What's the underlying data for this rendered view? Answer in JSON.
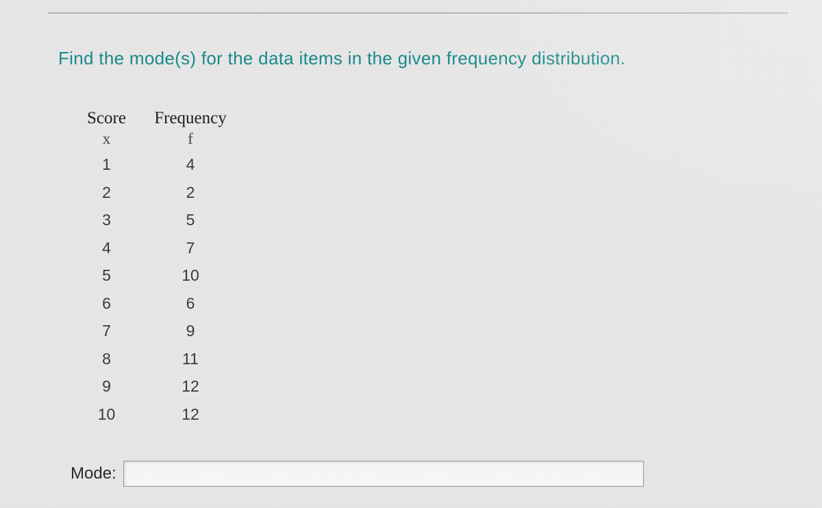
{
  "question": "Find the mode(s) for the data items in the given frequency distribution.",
  "table": {
    "header_score": "Score",
    "header_freq": "Frequency",
    "sym_score": "x",
    "sym_freq": "f",
    "rows": [
      {
        "x": "1",
        "f": "4"
      },
      {
        "x": "2",
        "f": "2"
      },
      {
        "x": "3",
        "f": "5"
      },
      {
        "x": "4",
        "f": "7"
      },
      {
        "x": "5",
        "f": "10"
      },
      {
        "x": "6",
        "f": "6"
      },
      {
        "x": "7",
        "f": "9"
      },
      {
        "x": "8",
        "f": "11"
      },
      {
        "x": "9",
        "f": "12"
      },
      {
        "x": "10",
        "f": "12"
      }
    ]
  },
  "answer": {
    "label": "Mode:",
    "value": ""
  }
}
